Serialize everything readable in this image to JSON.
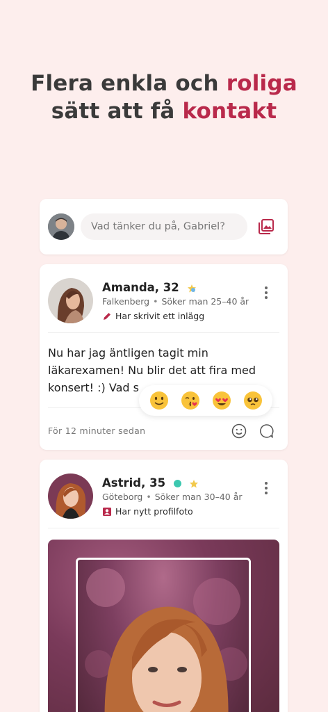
{
  "headline": {
    "line1_plain": "Flera enkla och ",
    "line1_accent": "roliga",
    "line2_plain": "sätt att få ",
    "line2_accent": "kontakt"
  },
  "composer": {
    "placeholder": "Vad tänker du på, Gabriel?"
  },
  "posts": [
    {
      "name": "Amanda, 32",
      "location": "Falkenberg",
      "seeking": "Söker man 25–40 år",
      "activity": "Har skrivit ett inlägg",
      "text": "Nu har jag äntligen tagit min läkarexamen! Nu blir det att fira med konsert! :) Vad s",
      "timestamp": "För 12 minuter sedan"
    },
    {
      "name": "Astrid, 35",
      "location": "Göteborg",
      "seeking": "Söker man 30–40 år",
      "activity": "Har nytt profilfoto"
    }
  ],
  "reactions": [
    "smiling-face",
    "kissing-face",
    "heart-eyes-face",
    "pleading-face"
  ],
  "colors": {
    "background": "#fdeeed",
    "accent": "#b9294b",
    "online": "#3cc8b0"
  }
}
